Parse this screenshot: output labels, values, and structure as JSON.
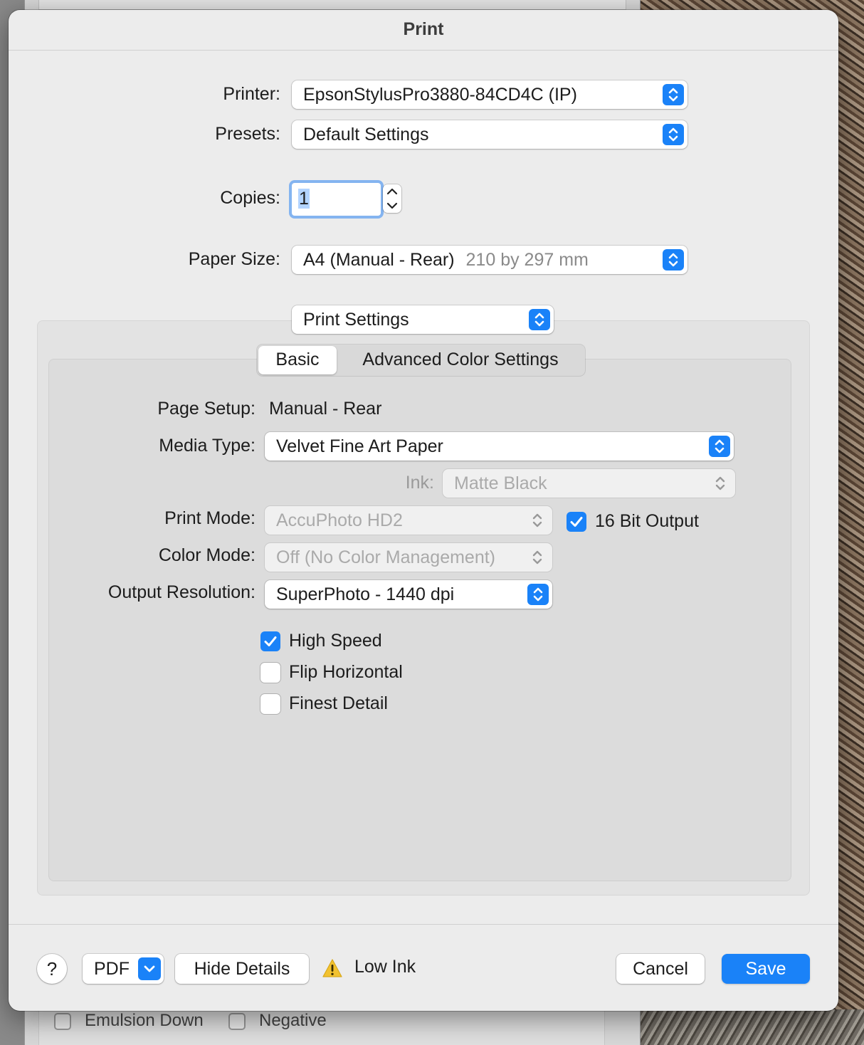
{
  "dialog": {
    "title": "Print"
  },
  "printer": {
    "label": "Printer:",
    "value": "EpsonStylusPro3880-84CD4C (IP)"
  },
  "presets": {
    "label": "Presets:",
    "value": "Default Settings"
  },
  "copies": {
    "label": "Copies:",
    "value": "1"
  },
  "paper_size": {
    "label": "Paper Size:",
    "value": "A4 (Manual - Rear)",
    "detail": "210 by 297 mm"
  },
  "panel_select": {
    "value": "Print Settings"
  },
  "tabs": [
    {
      "label": "Basic",
      "active": true
    },
    {
      "label": "Advanced Color Settings",
      "active": false
    }
  ],
  "settings": {
    "page_setup": {
      "label": "Page Setup:",
      "value": "Manual - Rear"
    },
    "media_type": {
      "label": "Media Type:",
      "value": "Velvet Fine Art Paper"
    },
    "ink": {
      "label": "Ink:",
      "value": "Matte Black",
      "enabled": false
    },
    "print_mode": {
      "label": "Print Mode:",
      "value": "AccuPhoto HD2",
      "enabled": false
    },
    "bit_output": {
      "label": "16 Bit Output",
      "checked": true
    },
    "color_mode": {
      "label": "Color Mode:",
      "value": "Off (No Color Management)",
      "enabled": false
    },
    "output_resolution": {
      "label": "Output Resolution:",
      "value": "SuperPhoto - 1440 dpi"
    },
    "high_speed": {
      "label": "High Speed",
      "checked": true
    },
    "flip_horizontal": {
      "label": "Flip Horizontal",
      "checked": false
    },
    "finest_detail": {
      "label": "Finest Detail",
      "checked": false
    }
  },
  "footer": {
    "help": "?",
    "pdf": "PDF",
    "hide_details": "Hide Details",
    "warning": "Low Ink",
    "cancel": "Cancel",
    "save": "Save"
  },
  "background": {
    "emulsion_down": "Emulsion Down",
    "negative": "Negative"
  },
  "colors": {
    "accent": "#1a82f8",
    "warning": "#f2c230"
  }
}
